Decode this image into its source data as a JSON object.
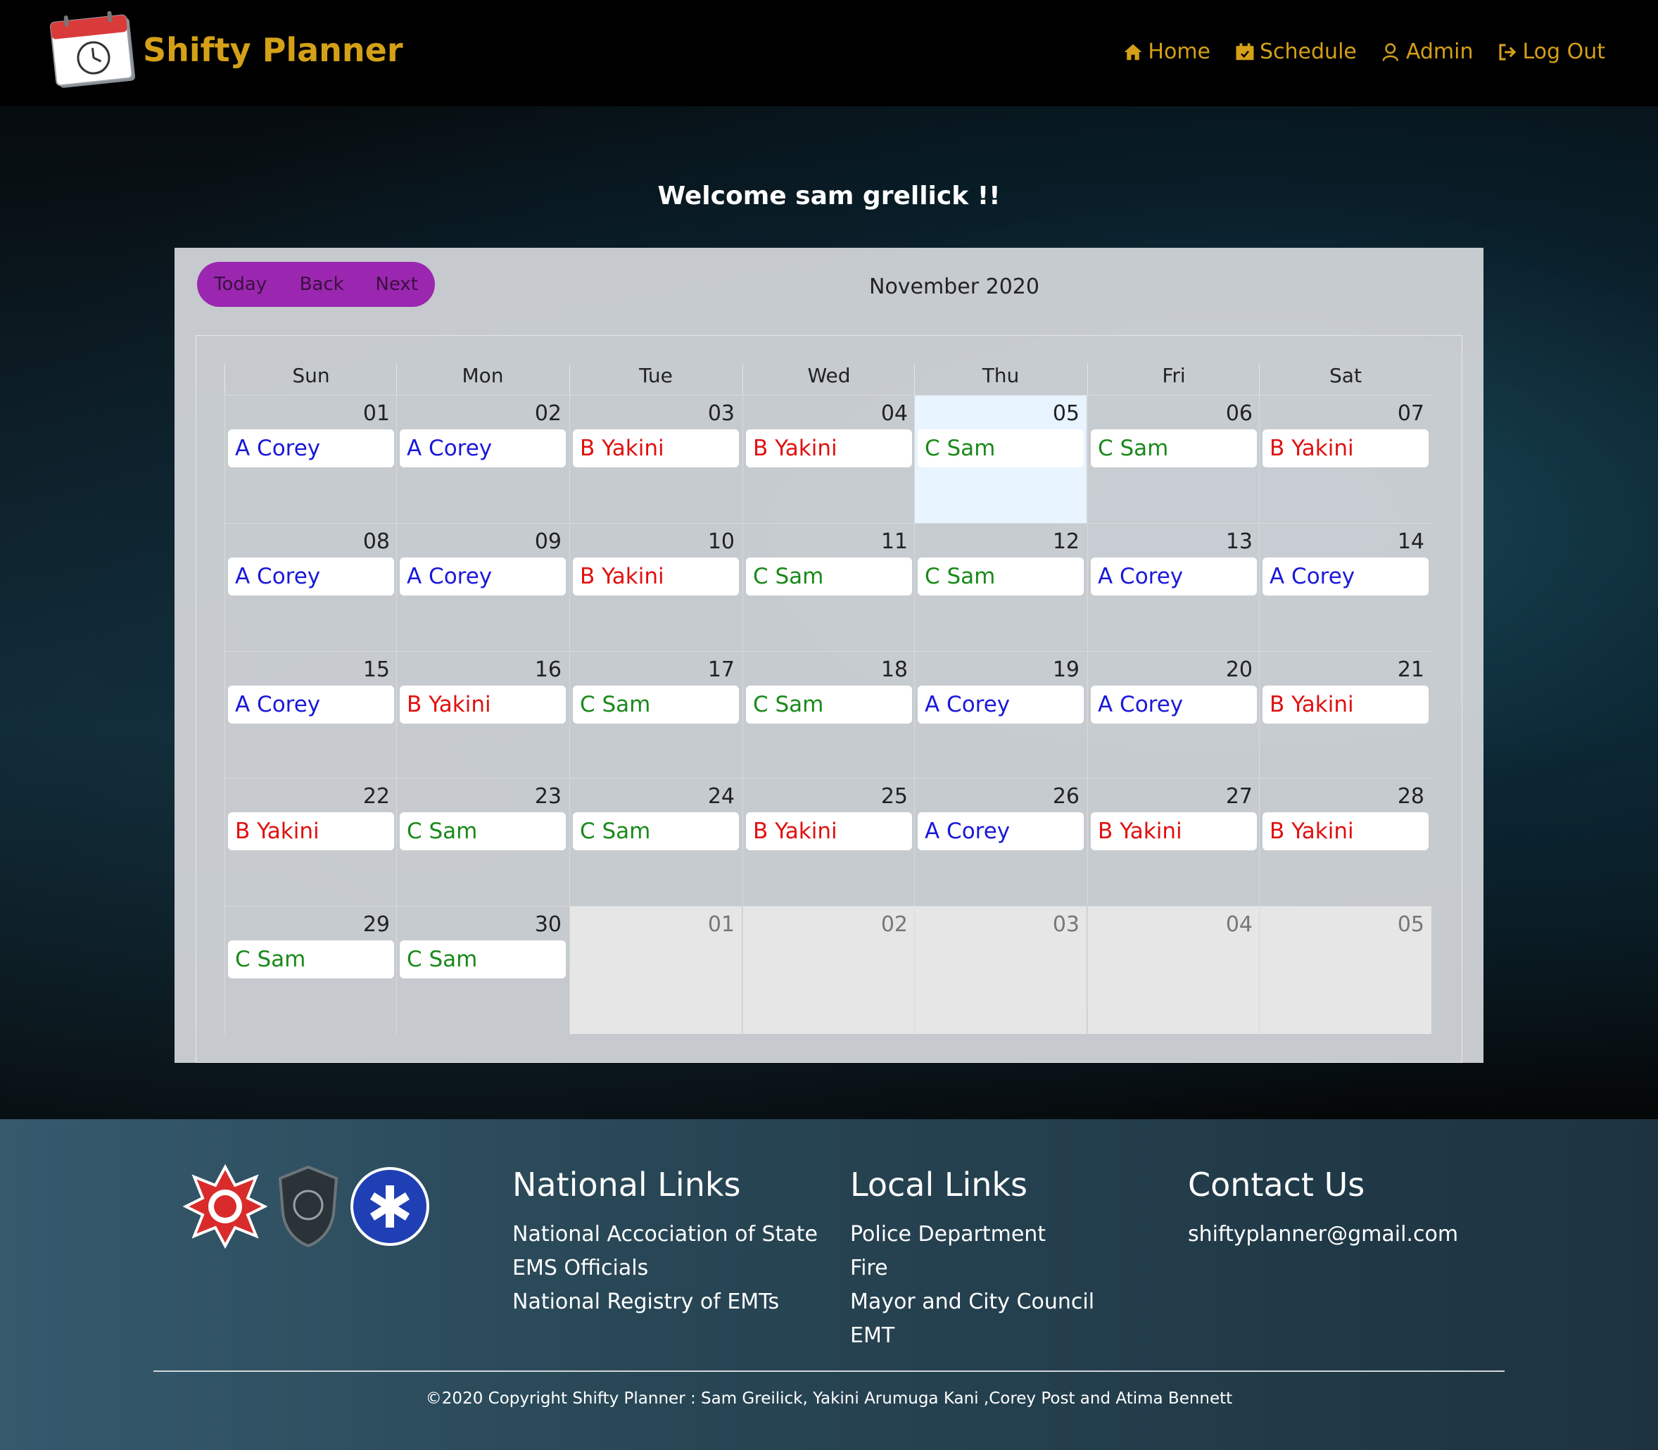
{
  "header": {
    "brand": "Shifty Planner",
    "logo_text": "SHIFTY PLANNER",
    "nav": [
      {
        "label": "Home",
        "icon": "home-icon"
      },
      {
        "label": "Schedule",
        "icon": "calendar-icon"
      },
      {
        "label": "Admin",
        "icon": "user-icon"
      },
      {
        "label": "Log Out",
        "icon": "logout-icon"
      }
    ],
    "accent_color": "#d4a017"
  },
  "welcome": "Welcome sam grellick !!",
  "calendar": {
    "toolbar": {
      "today": "Today",
      "back": "Back",
      "next": "Next"
    },
    "month_label": "November 2020",
    "weekdays": [
      "Sun",
      "Mon",
      "Tue",
      "Wed",
      "Thu",
      "Fri",
      "Sat"
    ],
    "weeks": [
      [
        {
          "day": "01",
          "event": "A Corey",
          "shift": "A"
        },
        {
          "day": "02",
          "event": "A Corey",
          "shift": "A"
        },
        {
          "day": "03",
          "event": "B Yakini",
          "shift": "B"
        },
        {
          "day": "04",
          "event": "B Yakini",
          "shift": "B"
        },
        {
          "day": "05",
          "event": "C Sam",
          "shift": "C",
          "today": true
        },
        {
          "day": "06",
          "event": "C Sam",
          "shift": "C"
        },
        {
          "day": "07",
          "event": "B Yakini",
          "shift": "B"
        }
      ],
      [
        {
          "day": "08",
          "event": "A Corey",
          "shift": "A"
        },
        {
          "day": "09",
          "event": "A Corey",
          "shift": "A"
        },
        {
          "day": "10",
          "event": "B Yakini",
          "shift": "B"
        },
        {
          "day": "11",
          "event": "C Sam",
          "shift": "C"
        },
        {
          "day": "12",
          "event": "C Sam",
          "shift": "C"
        },
        {
          "day": "13",
          "event": "A Corey",
          "shift": "A"
        },
        {
          "day": "14",
          "event": "A Corey",
          "shift": "A"
        }
      ],
      [
        {
          "day": "15",
          "event": "A Corey",
          "shift": "A"
        },
        {
          "day": "16",
          "event": "B Yakini",
          "shift": "B"
        },
        {
          "day": "17",
          "event": "C Sam",
          "shift": "C"
        },
        {
          "day": "18",
          "event": "C Sam",
          "shift": "C"
        },
        {
          "day": "19",
          "event": "A Corey",
          "shift": "A"
        },
        {
          "day": "20",
          "event": "A Corey",
          "shift": "A"
        },
        {
          "day": "21",
          "event": "B Yakini",
          "shift": "B"
        }
      ],
      [
        {
          "day": "22",
          "event": "B Yakini",
          "shift": "B"
        },
        {
          "day": "23",
          "event": "C Sam",
          "shift": "C"
        },
        {
          "day": "24",
          "event": "C Sam",
          "shift": "C"
        },
        {
          "day": "25",
          "event": "B Yakini",
          "shift": "B"
        },
        {
          "day": "26",
          "event": "A Corey",
          "shift": "A"
        },
        {
          "day": "27",
          "event": "B Yakini",
          "shift": "B"
        },
        {
          "day": "28",
          "event": "B Yakini",
          "shift": "B"
        }
      ],
      [
        {
          "day": "29",
          "event": "C Sam",
          "shift": "C"
        },
        {
          "day": "30",
          "event": "C Sam",
          "shift": "C"
        },
        {
          "day": "01",
          "other": true
        },
        {
          "day": "02",
          "other": true
        },
        {
          "day": "03",
          "other": true
        },
        {
          "day": "04",
          "other": true
        },
        {
          "day": "05",
          "other": true
        }
      ]
    ],
    "shift_colors": {
      "A": "#1a18d8",
      "B": "#e01010",
      "C": "#1a8a1a"
    }
  },
  "footer": {
    "badges": [
      {
        "name": "fire-dept-badge",
        "text": "FIRE DEPT"
      },
      {
        "name": "police-badge",
        "text": "POLICE"
      },
      {
        "name": "ems-badge",
        "text": "EMERGENCY MEDICAL SERVICES"
      }
    ],
    "national": {
      "title": "National Links",
      "links": [
        "National Accociation of State EMS Officials",
        "National Registry of EMTs"
      ]
    },
    "local": {
      "title": "Local Links",
      "links": [
        "Police Department",
        "Fire",
        "Mayor and City Council",
        "EMT"
      ]
    },
    "contact": {
      "title": "Contact Us",
      "email": "shiftyplanner@gmail.com"
    },
    "copyright": "©2020 Copyright Shifty Planner : Sam Greilick, Yakini Arumuga Kani ,Corey Post and Atima Bennett"
  }
}
